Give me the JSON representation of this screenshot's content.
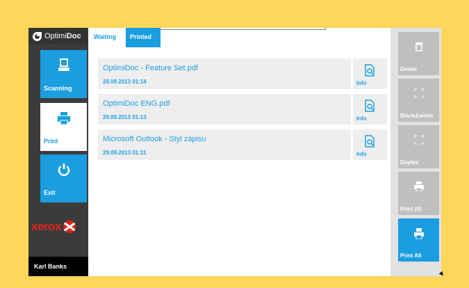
{
  "logo": {
    "prefix": "Optimi",
    "bold": "Doc"
  },
  "sidebar": {
    "items": [
      {
        "label": "Scanning",
        "icon": "scanner-icon"
      },
      {
        "label": "Print",
        "icon": "printer-icon",
        "active": true
      },
      {
        "label": "Exit",
        "icon": "power-icon"
      }
    ],
    "brand": "xerox",
    "user": "Karl Banks"
  },
  "tabs": [
    {
      "label": "Waiting"
    },
    {
      "label": "Printed",
      "active": true
    }
  ],
  "documents": [
    {
      "name": "OptimiDoc - Feature Set.pdf",
      "date": "29.09.2013 01:14",
      "info_label": "Info"
    },
    {
      "name": "OptimiDoc ENG.pdf",
      "date": "29.09.2013 01:13",
      "info_label": "Info"
    },
    {
      "name": "Microsoft Outlook - Styl zápisu",
      "date": "29.09.2013 01:11",
      "info_label": "Info"
    }
  ],
  "actions": [
    {
      "label": "Delete",
      "icon": "trash-icon"
    },
    {
      "label": "Black&white",
      "icon": "color-mode-icon"
    },
    {
      "label": "Duplex",
      "icon": "duplex-icon"
    },
    {
      "label": "Print (0)",
      "icon": "printer-icon"
    },
    {
      "label": "Print All",
      "icon": "printer-icon",
      "primary": true
    }
  ],
  "colors": {
    "accent": "#1a9ee0",
    "frame": "#fdd65a",
    "disabled": "#bfbfbf",
    "brand": "#e2231a"
  }
}
